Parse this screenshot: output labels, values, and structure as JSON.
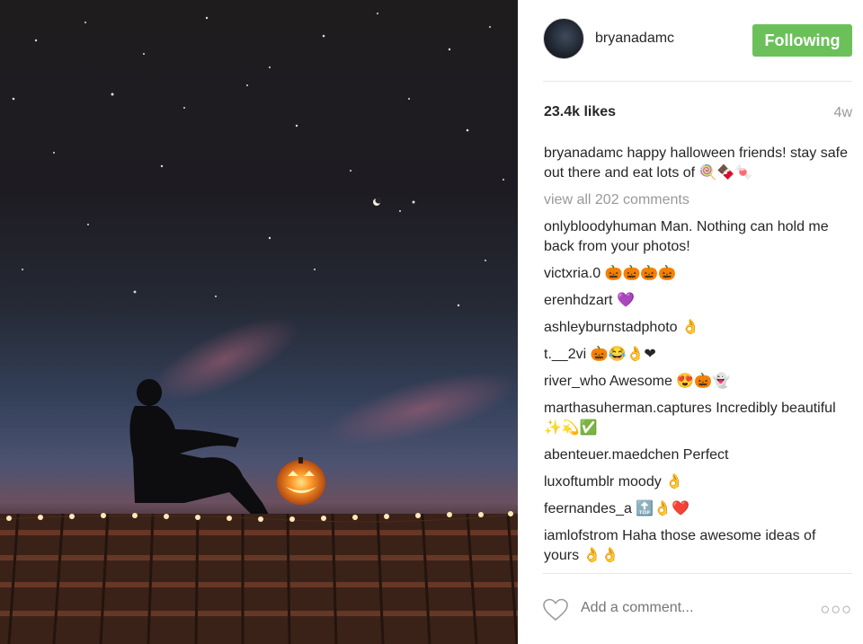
{
  "post": {
    "username": "bryanadamc",
    "follow_label": "Following",
    "likes": "23.4k likes",
    "age": "4w",
    "caption_user": "bryanadamc",
    "caption_text": "happy halloween friends! stay safe out there and eat lots of 🍭🍫🍬",
    "view_all": "view all 202 comments"
  },
  "comments": [
    {
      "user": "onlybloodyhuman",
      "text": "Man. Nothing can hold me back from your photos!"
    },
    {
      "user": "victxria.0",
      "text": "🎃🎃🎃🎃"
    },
    {
      "user": "erenhdzart",
      "text": "💜"
    },
    {
      "user": "ashleyburnstadphoto",
      "text": "👌"
    },
    {
      "user": "t.__2vi",
      "text": "🎃😂👌❤"
    },
    {
      "user": "river_who",
      "text": "Awesome 😍🎃👻"
    },
    {
      "user": "marthasuherman.captures",
      "text": "Incredibly beautiful ✨💫✅"
    },
    {
      "user": "abenteuer.maedchen",
      "text": "Perfect"
    },
    {
      "user": "luxoftumblr",
      "text": "moody 👌"
    },
    {
      "user": "feernandes_a",
      "text": "🔝👌❤️"
    },
    {
      "user": "iamlofstrom",
      "text": "Haha those awesome ideas of yours 👌👌"
    }
  ],
  "footer": {
    "add_comment_placeholder": "Add a comment...",
    "more_label": "○○○"
  },
  "colors": {
    "following_button": "#6bc05a",
    "muted_text": "#999999"
  },
  "icons": {
    "like": "heart-icon",
    "more": "more-options-icon"
  }
}
